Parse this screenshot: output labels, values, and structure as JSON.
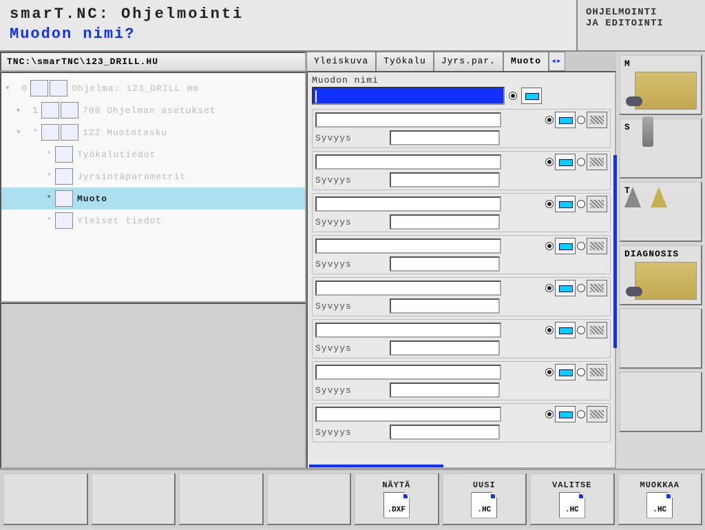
{
  "header": {
    "title": "smarT.NC: Ohjelmointi",
    "subtitle": "Muodon nimi?",
    "mode": "OHJELMOINTI",
    "mode2": "JA EDITOINTI"
  },
  "path": "TNC:\\smarTNC\\123_DRILL.HU",
  "tree": [
    {
      "toggle": "▿",
      "num": "0",
      "label": "Ohjelma: 123_DRILL mm",
      "indent": 0,
      "on": false,
      "icons": 2
    },
    {
      "toggle": "▹",
      "num": "1",
      "label": "700 Ohjelman asetukset",
      "indent": 1,
      "on": false,
      "icons": 2
    },
    {
      "toggle": "▿",
      "num": "*",
      "label": "122 Muototasku",
      "indent": 1,
      "on": false,
      "icons": 2
    },
    {
      "toggle": "",
      "num": "*",
      "label": "Työkalutiedot",
      "indent": 2,
      "on": false,
      "icons": 1
    },
    {
      "toggle": "",
      "num": "*",
      "label": "Jyrsintäparametrit",
      "indent": 2,
      "on": false,
      "icons": 1
    },
    {
      "toggle": "",
      "num": "*",
      "label": "Muoto",
      "indent": 2,
      "on": true,
      "icons": 1,
      "selected": true
    },
    {
      "toggle": "",
      "num": "*",
      "label": "Yleiset tiedot",
      "indent": 2,
      "on": false,
      "icons": 1
    }
  ],
  "tabs": [
    "Yleiskuva",
    "Työkalu",
    "Jyrs.par.",
    "Muoto"
  ],
  "activeTab": 3,
  "form": {
    "legend": "Muodon nimi",
    "depthLabel": "Syvyys",
    "rowCount": 8
  },
  "sideButtons": [
    {
      "label": "M",
      "img": "mill"
    },
    {
      "label": "S",
      "img": "tool"
    },
    {
      "label": "T",
      "img": "tt"
    },
    {
      "label": "DIAGNOSIS",
      "img": "mill"
    },
    {
      "label": "",
      "img": ""
    },
    {
      "label": "",
      "img": ""
    }
  ],
  "footer": [
    {
      "label": "",
      "ext": ""
    },
    {
      "label": "",
      "ext": ""
    },
    {
      "label": "",
      "ext": ""
    },
    {
      "label": "",
      "ext": ""
    },
    {
      "label": "NÄYTÄ",
      "ext": ".DXF"
    },
    {
      "label": "UUSI",
      "ext": ".HC"
    },
    {
      "label": "VALITSE",
      "ext": ".HC"
    },
    {
      "label": "MUOKKAA",
      "ext": ".HC"
    }
  ]
}
